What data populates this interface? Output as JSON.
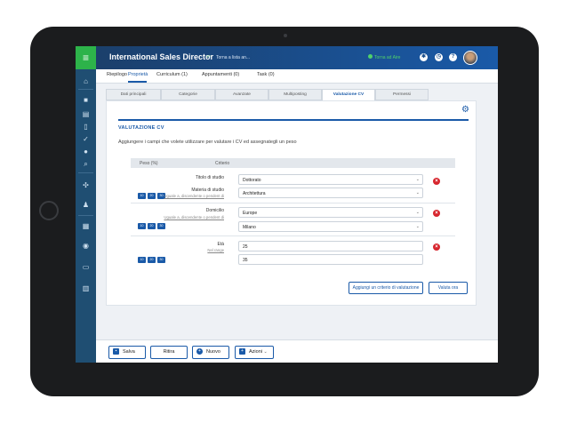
{
  "app": {
    "title": "International Sales Director",
    "back_label": "Torna a lista an...",
    "status_label": "Torna ad Aire",
    "menu_icon": "hamburger-icon"
  },
  "topbar_icons": [
    "settings-icon",
    "clock-icon",
    "help-icon"
  ],
  "subtabs": [
    "Riepilogo",
    "Proprietà",
    "Curriculum (1)",
    "Appuntamenti (0)",
    "Task (0)"
  ],
  "panel_tabs": [
    "Dati principali",
    "Categorie",
    "Avanzate",
    "Multiposting",
    "Valutazione CV",
    "Permessi"
  ],
  "section": {
    "title": "VALUTAZIONE CV",
    "description": "Aggiungere i campi che volete utilizzare per valutare i CV ed assegnategli un peso"
  },
  "table": {
    "col_weight": "Peso (%)",
    "col_criteria": "Criterio",
    "rows": [
      {
        "weights": [
          "10",
          "20",
          "30"
        ],
        "label1": "Titolo di studio",
        "label2": "Materia di studio",
        "link": "Uguale a, discendente o pendent di",
        "value1": "Dottorato",
        "value2": "Architettura"
      },
      {
        "weights": [
          "10",
          "20",
          "30"
        ],
        "label1": "Domicilio",
        "link": "Uguale a, discendente o pendent di",
        "value1": "Europe",
        "value2": "Milano"
      },
      {
        "weights": [
          "10",
          "20",
          "30"
        ],
        "label1": "Età",
        "link": "Nel range",
        "value1": "25",
        "value2": "35"
      }
    ]
  },
  "buttons": {
    "add_criteria": "Aggiungi un criterio di valutazione",
    "evaluate": "Valuta ora"
  },
  "footer": {
    "save": "Salva",
    "withdraw": "Ritira",
    "new": "Nuovo",
    "actions": "Azioni"
  }
}
